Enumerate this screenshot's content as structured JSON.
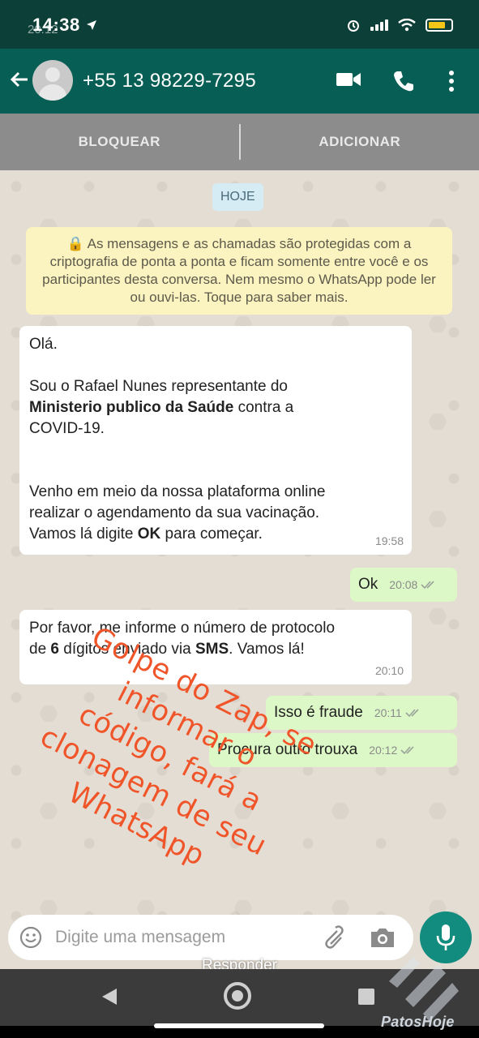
{
  "status_bar": {
    "time": "14:38",
    "time_background": "20:12",
    "location_icon": "location-arrow-icon",
    "battery_color": "#f5c518"
  },
  "header": {
    "contact": "+55 13 98229-7295",
    "bg_color": "#075e54"
  },
  "actions": {
    "block": "BLOQUEAR",
    "add": "ADICIONAR"
  },
  "chat": {
    "date_chip": "HOJE",
    "encryption_note": "🔒 As mensagens e as chamadas são protegidas com a criptografia de ponta a ponta e ficam somente entre você e os participantes desta conversa. Nem mesmo o WhatsApp pode ler ou ouvi-las. Toque para saber mais.",
    "messages": [
      {
        "direction": "in",
        "greeting": "Olá.",
        "line1": "Sou o Rafael Nunes representante do",
        "line2_bold": "Ministerio publico da Saúde",
        "line2_rest": " contra a",
        "line3": "COVID-19.",
        "line4": "Venho em meio da nossa plataforma online",
        "line5": "realizar  o agendamento da sua vacinação.",
        "line6_pre": "Vamos lá digite ",
        "line6_bold": "OK",
        "line6_post": " para começar.",
        "time": "19:58"
      },
      {
        "direction": "out",
        "text": "Ok",
        "time": "20:08"
      },
      {
        "direction": "in",
        "line1": "Por favor, me informe o número de protocolo",
        "line2_pre": "de ",
        "line2_bold1": "6",
        "line2_mid": " dígitos enviado via ",
        "line2_bold2": "SMS",
        "line2_post": ". Vamos lá!",
        "time": "20:10"
      },
      {
        "direction": "out",
        "text": "Isso é fraude",
        "time": "20:11"
      },
      {
        "direction": "out",
        "text": "Procura outro trouxa",
        "time": "20:12"
      }
    ]
  },
  "overlay": {
    "lines": [
      "Golpe do Zap, se",
      "informar o",
      "código, fará a",
      "clonagem de seu",
      "WhatsApp"
    ],
    "color": "#f0552a"
  },
  "input": {
    "placeholder": "Digite uma mensagem"
  },
  "reply": {
    "label": "Responder"
  },
  "watermark": {
    "text": "PatosHoje"
  }
}
